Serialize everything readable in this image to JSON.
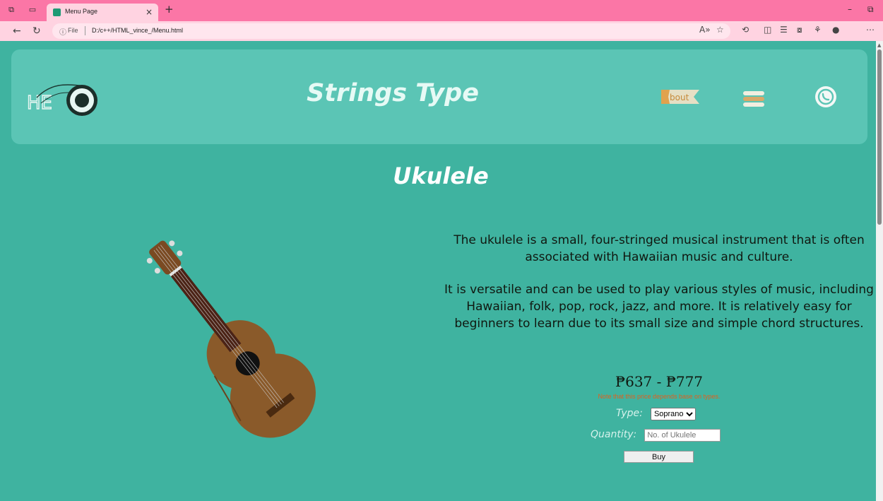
{
  "browser": {
    "tab_title": "Menu Page",
    "tab_close": "×",
    "new_tab": "+",
    "file_label": "File",
    "url": "D:/c++/HTML_vince_/Menu.html",
    "accent_color": "#fb76a6"
  },
  "header": {
    "site_title": "Strings Type",
    "logo_text": "HE",
    "about_label": "bout"
  },
  "product": {
    "title": "Ukulele",
    "description": [
      "The ukulele is a small, four-stringed musical instrument that is often associated with Hawaiian music and culture.",
      "It is versatile and can be used to play various styles of music, including Hawaiian, folk, pop, rock, jazz, and more. It is relatively easy for beginners to learn due to its small size and simple chord structures."
    ],
    "price": "₱637 - ₱777",
    "note": "Note that this price depends base on types.",
    "type_label": "Type:",
    "type_selected": "Soprano",
    "quantity_label": "Quantity:",
    "quantity_placeholder": "No. of Ukulele",
    "buy_label": "Buy"
  },
  "colors": {
    "page_bg": "#3fb3a0",
    "header_bg": "#5bc5b5",
    "note": "#e0601e"
  },
  "icons": [
    "workspaces-icon",
    "tab-actions-icon",
    "back-icon",
    "refresh-icon",
    "info-icon",
    "read-aloud-icon",
    "favorite-icon",
    "extensions-icon",
    "split-screen-icon",
    "favorites-bar-icon",
    "collections-icon",
    "profile-icon",
    "more-icon",
    "whatsapp-icon",
    "menu-icon"
  ]
}
